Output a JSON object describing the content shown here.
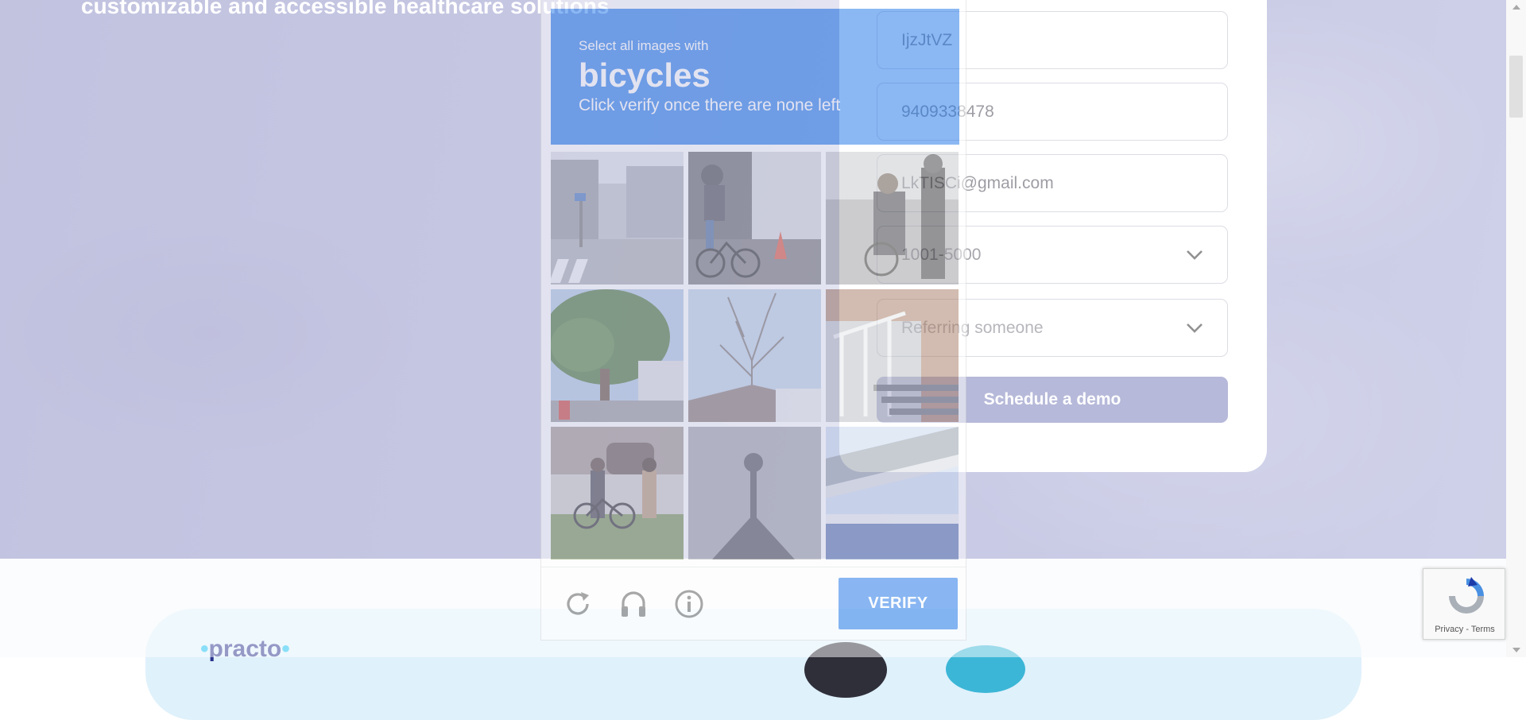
{
  "hero": {
    "subtitle": "customizable and accessible healthcare solutions"
  },
  "demo_form": {
    "name_value": "IjzJtVZ",
    "phone_value": "9409338478",
    "email_value": "LkTISCi@gmail.com",
    "company_size_value": "1001-5000",
    "reason_value": "Referring someone",
    "submit_label": "Schedule a demo"
  },
  "captcha": {
    "instruction_line1": "Select all images with",
    "target_word": "bicycles",
    "instruction_line3": "Click verify once there are none left",
    "verify_label": "VERIFY",
    "tiles": [
      {
        "label": "street with crosswalk"
      },
      {
        "label": "person riding bicycle"
      },
      {
        "label": "pedestrians with bicycle"
      },
      {
        "label": "tree"
      },
      {
        "label": "bare tree"
      },
      {
        "label": "stair railing"
      },
      {
        "label": "people walking with bicycle"
      },
      {
        "label": "shadow on wall"
      },
      {
        "label": "overpass"
      }
    ]
  },
  "partners": {
    "logo_text": "practo"
  },
  "recaptcha_badge": {
    "links": "Privacy - Terms"
  },
  "icons": {
    "refresh": "refresh-icon",
    "audio": "headphones-icon",
    "info": "info-icon",
    "chevron": "chevron-down-icon",
    "recaptcha": "recaptcha-logo-icon"
  },
  "colors": {
    "captcha_blue": "#1a73e8",
    "schedule_button": "#6d72b2",
    "hero_background": "#8b8ec5"
  }
}
